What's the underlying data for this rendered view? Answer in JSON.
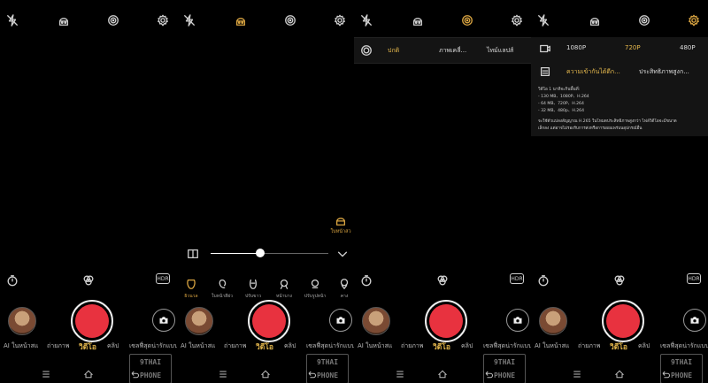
{
  "modes": [
    "AI ในหน้าสแ",
    "ถ่ายภาพ",
    "วิดีโอ",
    "คลิป",
    "เซลฟี่สุดน่ารักแบบ AR"
  ],
  "active_mode_index": 2,
  "watermark": {
    "line1": "9THAI",
    "line2": "PHONE"
  },
  "hdr_label": "HDR",
  "beauty": {
    "selected_label": "ใบหน้าสว",
    "slider_value": 0.42,
    "items": [
      "ผิวนวล",
      "ใบหน้าสีย่ว",
      "ปรับขาว",
      "หน้าบาง",
      "ปรับรูปหน้า",
      "คาง"
    ],
    "active_item_index": 0
  },
  "live_photo": {
    "options": [
      "ปกติ",
      "ภาพเคลื่...",
      "ไทม์แลปส์"
    ],
    "selected_index": 0
  },
  "resolution": {
    "options": [
      "1080P",
      "720P",
      "480P"
    ],
    "selected_index": 1,
    "frame_options": [
      "ความเข้ากันได้ดีก...",
      "ประสิทธิภาพสูงก..."
    ],
    "frame_selected_index": 0,
    "info_lines": [
      "วิดีโอ 1 นาทีจะกินพื้นที่:",
      "- 130 MB、1080P、H.264",
      "- 64 MB、720P、H.264",
      "- 32 MB、480p、H.264",
      "จะใช้ตัวแปลงสัญญาณ H.265 ในโหมดประสิทธิภาพสูงกว่า ไฟล์วิดีโอจะมีขนาด",
      "เล็กลง แต่อาจไม่รองรับการส่งหรือการเผยแพร่บนอุปกรณ์อื่น"
    ]
  },
  "colors": {
    "accent": "#e5b84d",
    "shutter": "#e8323f"
  }
}
